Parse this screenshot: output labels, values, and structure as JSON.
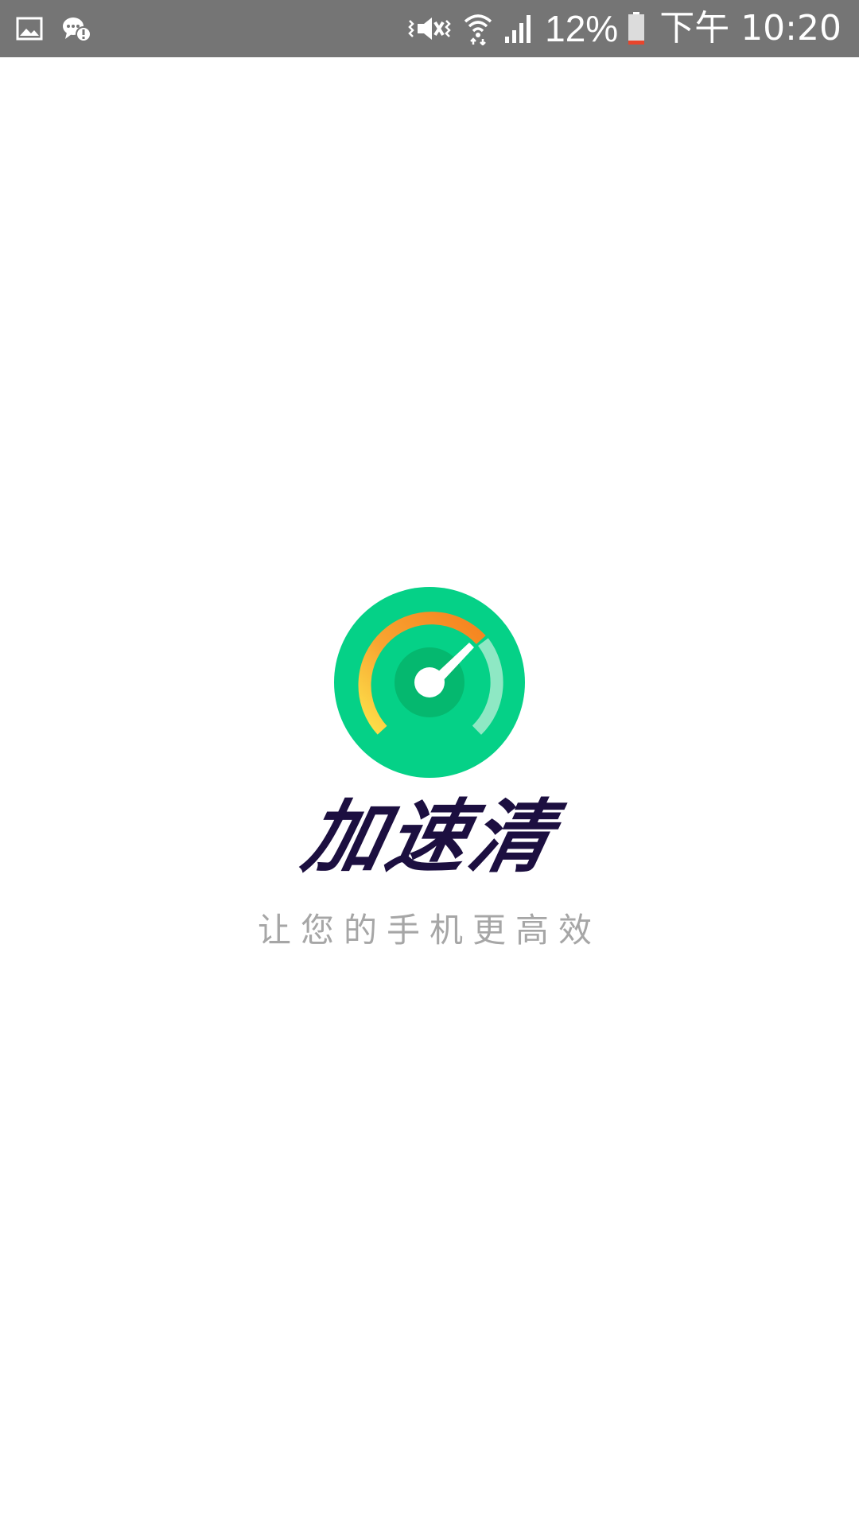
{
  "status_bar": {
    "icons_left": [
      "gallery-icon",
      "notification-icon"
    ],
    "icons_right": [
      "vibrate-mute-icon",
      "wifi-icon",
      "signal-icon",
      "battery-icon"
    ],
    "battery_percent": "12%",
    "battery_level": 0.12,
    "time": "下午 10:20",
    "background_color": "#757575"
  },
  "splash": {
    "logo_icon": "speedometer-icon",
    "app_name": "加速清",
    "tagline": "让您的手机更高效",
    "colors": {
      "logo_green": "#05d187",
      "logo_dark_green": "#05b86f",
      "gauge_orange": "#f5821f",
      "gauge_yellow": "#fde34b",
      "gauge_mint": "#8ee8c4",
      "title": "#1c0f40",
      "tagline": "#a6a6a6"
    }
  }
}
